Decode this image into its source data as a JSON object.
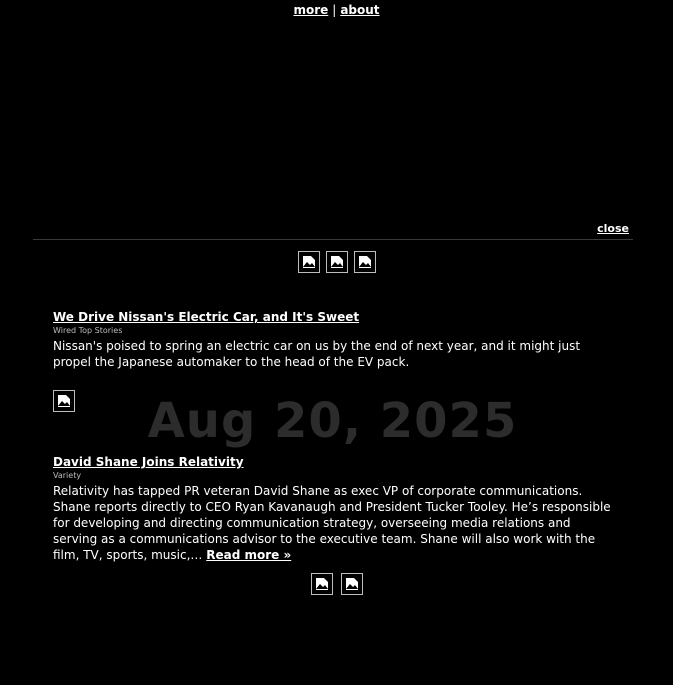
{
  "nav": {
    "more_label": "more",
    "separator": "|",
    "about_label": "about"
  },
  "panel": {
    "close_label": "close"
  },
  "date_watermark": "Aug 20, 2025",
  "articles": [
    {
      "title": "We Drive Nissan's Electric Car, and It's Sweet",
      "source": "Wired Top Stories",
      "summary": "Nissan's poised to spring an electric car on us by the end of next year, and it might just propel the Japanese automaker to the head of the EV pack."
    },
    {
      "title": "David Shane Joins Relativity",
      "source": "Variety",
      "summary": "Relativity has tapped PR veteran David Shane as exec VP of corporate communications. Shane reports directly to CEO Ryan Kavanaugh and President Tucker Tooley. He’s responsible for developing and directing communication strategy, overseeing media relations and serving as a communications advisor to the executive team. Shane will also work with the film, TV, sports, music,…",
      "read_more": "Read more »"
    }
  ],
  "icons": {
    "broken_image": "broken-image-icon"
  }
}
